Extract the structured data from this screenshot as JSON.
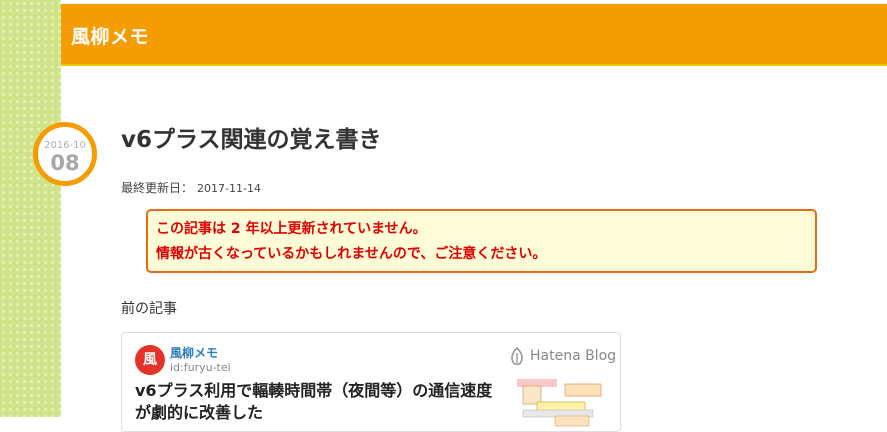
{
  "site": {
    "title": "風柳メモ"
  },
  "date": {
    "year_month": "2016-10",
    "day": "08"
  },
  "entry": {
    "title": "v6プラス関連の覚え書き",
    "updated_label": "最終更新日：",
    "updated_date": "2017-11-14"
  },
  "notice": {
    "line1": "この記事は 2 年以上更新されていません。",
    "line2": "情報が古くなっているかもしれませんので、ご注意ください。"
  },
  "prev": {
    "label": "前の記事",
    "card": {
      "site_name": "風柳メモ",
      "user_id": "id:furyu-tei",
      "provider": "Hatena Blog",
      "title": "v6プラス利用で輻輳時間帯（夜間等）の通信速度が劇的に改善した",
      "favicon_char": "風"
    }
  },
  "colors": {
    "header": "#f59c00",
    "side": "#cfe48a",
    "notice_border": "#e56a1a",
    "notice_bg": "#fffcd8",
    "notice_text": "#e00000"
  }
}
